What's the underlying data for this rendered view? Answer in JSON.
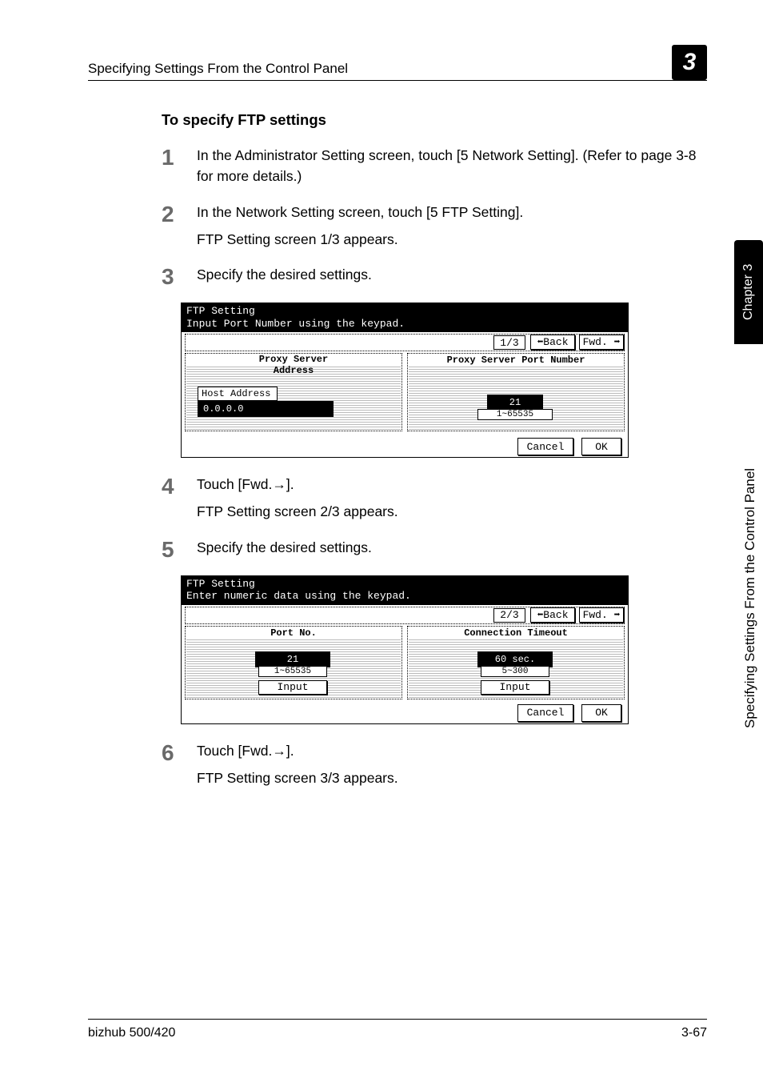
{
  "header": {
    "title": "Specifying Settings From the Control Panel",
    "chapter_num": "3"
  },
  "section_title": "To specify FTP settings",
  "steps": [
    {
      "num": "1",
      "text": "In the Administrator Setting screen, touch [5 Network Setting]. (Refer to page 3-8 for more details.)",
      "sub": ""
    },
    {
      "num": "2",
      "text": "In the Network Setting screen, touch [5 FTP Setting].",
      "sub": "FTP Setting screen 1/3 appears."
    },
    {
      "num": "3",
      "text": "Specify the desired settings.",
      "sub": ""
    },
    {
      "num": "4",
      "text": "Touch [Fwd.→].",
      "sub": "FTP Setting screen 2/3 appears."
    },
    {
      "num": "5",
      "text": "Specify the desired settings.",
      "sub": ""
    },
    {
      "num": "6",
      "text": "Touch [Fwd.→].",
      "sub": "FTP Setting screen 3/3 appears."
    }
  ],
  "screen1": {
    "title_line1": "FTP Setting",
    "title_line2": "Input Port Number using the keypad.",
    "pager": "1/3",
    "back": "⬅Back",
    "fwd": "Fwd. ➡",
    "left_heading": "Proxy Server\nAddress",
    "right_heading": "Proxy Server Port Number",
    "host_tab": "Host Address",
    "host_value": "0.0.0.0",
    "port_value": "21",
    "port_range": "1~65535",
    "cancel": "Cancel",
    "ok": "OK"
  },
  "screen2": {
    "title_line1": "FTP Setting",
    "title_line2": "Enter numeric data using the keypad.",
    "pager": "2/3",
    "back": "⬅Back",
    "fwd": "Fwd. ➡",
    "left_heading": "Port No.",
    "right_heading": "Connection Timeout",
    "port_value": "21",
    "port_range": "1~65535",
    "timeout_value": "60 sec.",
    "timeout_range": "5~300",
    "input": "Input",
    "cancel": "Cancel",
    "ok": "OK"
  },
  "side": {
    "chapter_label": "Chapter 3",
    "side_caption": "Specifying Settings From the Control Panel"
  },
  "footer": {
    "left": "bizhub 500/420",
    "right": "3-67"
  }
}
